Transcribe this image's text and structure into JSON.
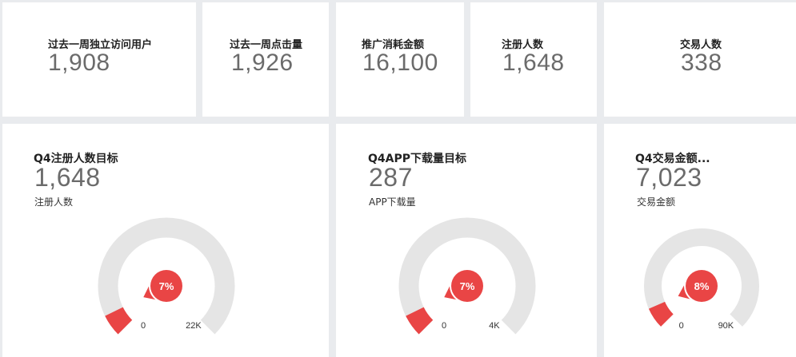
{
  "kpis": [
    {
      "label": "过去一周独立访问用户",
      "value": "1,908"
    },
    {
      "label": "过去一周点击量",
      "value": "1,926"
    },
    {
      "label": "推广消耗金额",
      "value": "16,100"
    },
    {
      "label": "注册人数",
      "value": "1,648"
    },
    {
      "label": "交易人数",
      "value": "338"
    }
  ],
  "gauges": [
    {
      "title": "Q4注册人数目标",
      "value": "1,648",
      "subtitle": "注册人数",
      "percent": 7,
      "percent_label": "7%",
      "min_label": "0",
      "max_label": "22K"
    },
    {
      "title": "Q4APP下载量目标",
      "value": "287",
      "subtitle": "APP下载量",
      "percent": 7,
      "percent_label": "7%",
      "min_label": "0",
      "max_label": "4K"
    },
    {
      "title": "Q4交易金额...",
      "value": "7,023",
      "subtitle": "交易金额",
      "percent": 8,
      "percent_label": "8%",
      "min_label": "0",
      "max_label": "90K"
    }
  ],
  "colors": {
    "accent": "#e94545",
    "track": "#e5e5e5",
    "background": "#e9ebee",
    "card": "#ffffff"
  }
}
